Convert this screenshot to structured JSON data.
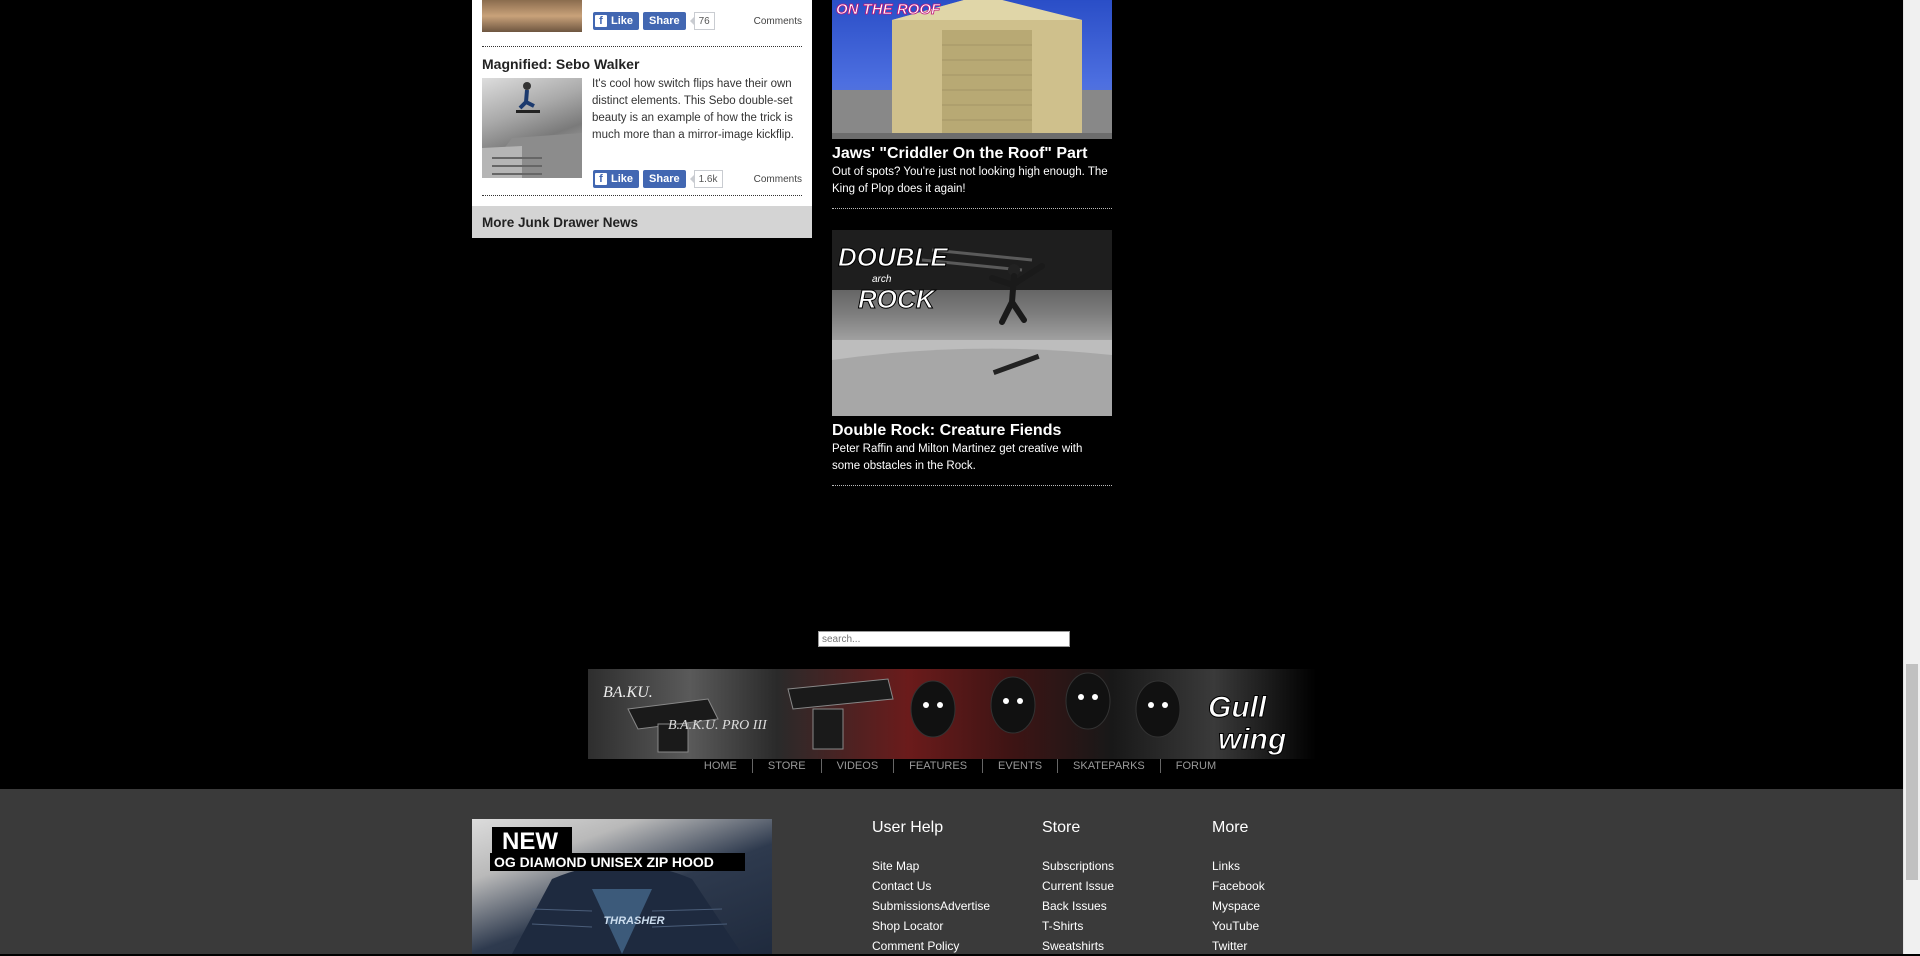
{
  "junk_drawer": {
    "item1": {
      "like_label": "Like",
      "share_label": "Share",
      "count": "76",
      "comments_label": "Comments"
    },
    "item2": {
      "title": "Magnified: Sebo Walker",
      "excerpt": "It's cool how switch flips have their own distinct elements. This Sebo double-set beauty is an example of how the trick is much more than a mirror-image kickflip.",
      "like_label": "Like",
      "share_label": "Share",
      "count": "1.6k",
      "comments_label": "Comments"
    },
    "more_link": "More Junk Drawer News"
  },
  "features": {
    "item1": {
      "image_text": "ON THE ROOF",
      "title": "Jaws' \"Criddler On the Roof\" Part",
      "excerpt": "Out of spots? You're just not looking high enough. The King of Plop does it again!"
    },
    "item2": {
      "image_text_1": "DOUBLE",
      "image_text_2": "ROCK",
      "image_text_small": "arch",
      "title": "Double Rock: Creature Fiends",
      "excerpt": "Peter Raffin and Milton Martinez get creative with some obstacles in the Rock."
    }
  },
  "search": {
    "placeholder": "search..."
  },
  "banner": {
    "brand_text": "BA.KU.",
    "product_text": "B.A.K.U. PRO III",
    "logo_text_1": "Gull",
    "logo_text_2": "wing"
  },
  "nav": [
    "HOME",
    "STORE",
    "VIDEOS",
    "FEATURES",
    "EVENTS",
    "SKATEPARKS",
    "FORUM"
  ],
  "footer": {
    "ad_headline_1": "NEW",
    "ad_headline_2": "OG DIAMOND UNISEX ZIP HOOD",
    "ad_logo": "THRASHER",
    "user_help": {
      "heading": "User Help",
      "links": [
        "Site Map",
        "Contact Us",
        "SubmissionsAdvertise",
        "Shop Locator",
        "Comment Policy"
      ]
    },
    "store": {
      "heading": "Store",
      "links": [
        "Subscriptions",
        "Current Issue",
        "Back Issues",
        "T-Shirts",
        "Sweatshirts"
      ]
    },
    "more": {
      "heading": "More",
      "links": [
        "Links",
        "Facebook",
        "Myspace",
        "YouTube",
        "Twitter"
      ]
    }
  },
  "colors": {
    "page_bg": "#000000",
    "facebook_blue": "#4267b2",
    "footer_bg": "#3a3a3a",
    "panel_header_bg": "#d4d4d4"
  }
}
